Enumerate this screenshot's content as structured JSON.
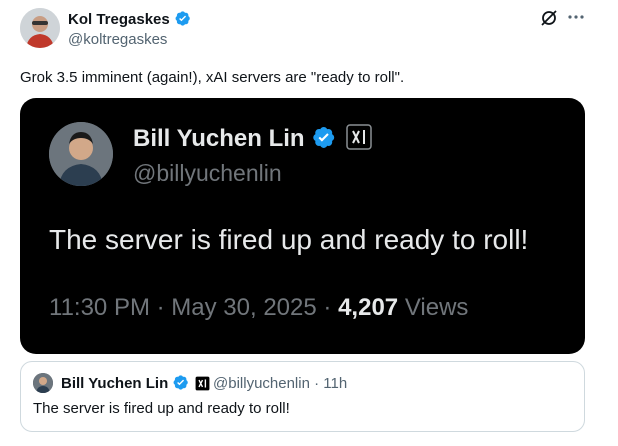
{
  "author": {
    "name": "Kol Tregaskes",
    "handle": "@koltregaskes"
  },
  "tweet": {
    "text": "Grok 3.5 imminent (again!), xAI servers are \"ready to roll\"."
  },
  "media": {
    "name": "Bill Yuchen Lin",
    "handle": "@billyuchenlin",
    "text": "The server is fired up and ready to roll!",
    "time": "11:30 PM",
    "date": "May 30, 2025",
    "views_count": "4,207",
    "views_label": "Views",
    "separator": "·"
  },
  "quote": {
    "name": "Bill Yuchen Lin",
    "handle_time": "@billyuchenlin · 11h",
    "text": "The server is fired up and ready to roll!"
  },
  "icons": {
    "verified": "verified-badge-icon",
    "grok": "grok-icon",
    "more": "more-icon",
    "xai": "xai-affiliate-icon"
  },
  "colors": {
    "verified_blue": "#1d9bf0",
    "text_primary": "#0f1419",
    "text_secondary": "#536471"
  }
}
